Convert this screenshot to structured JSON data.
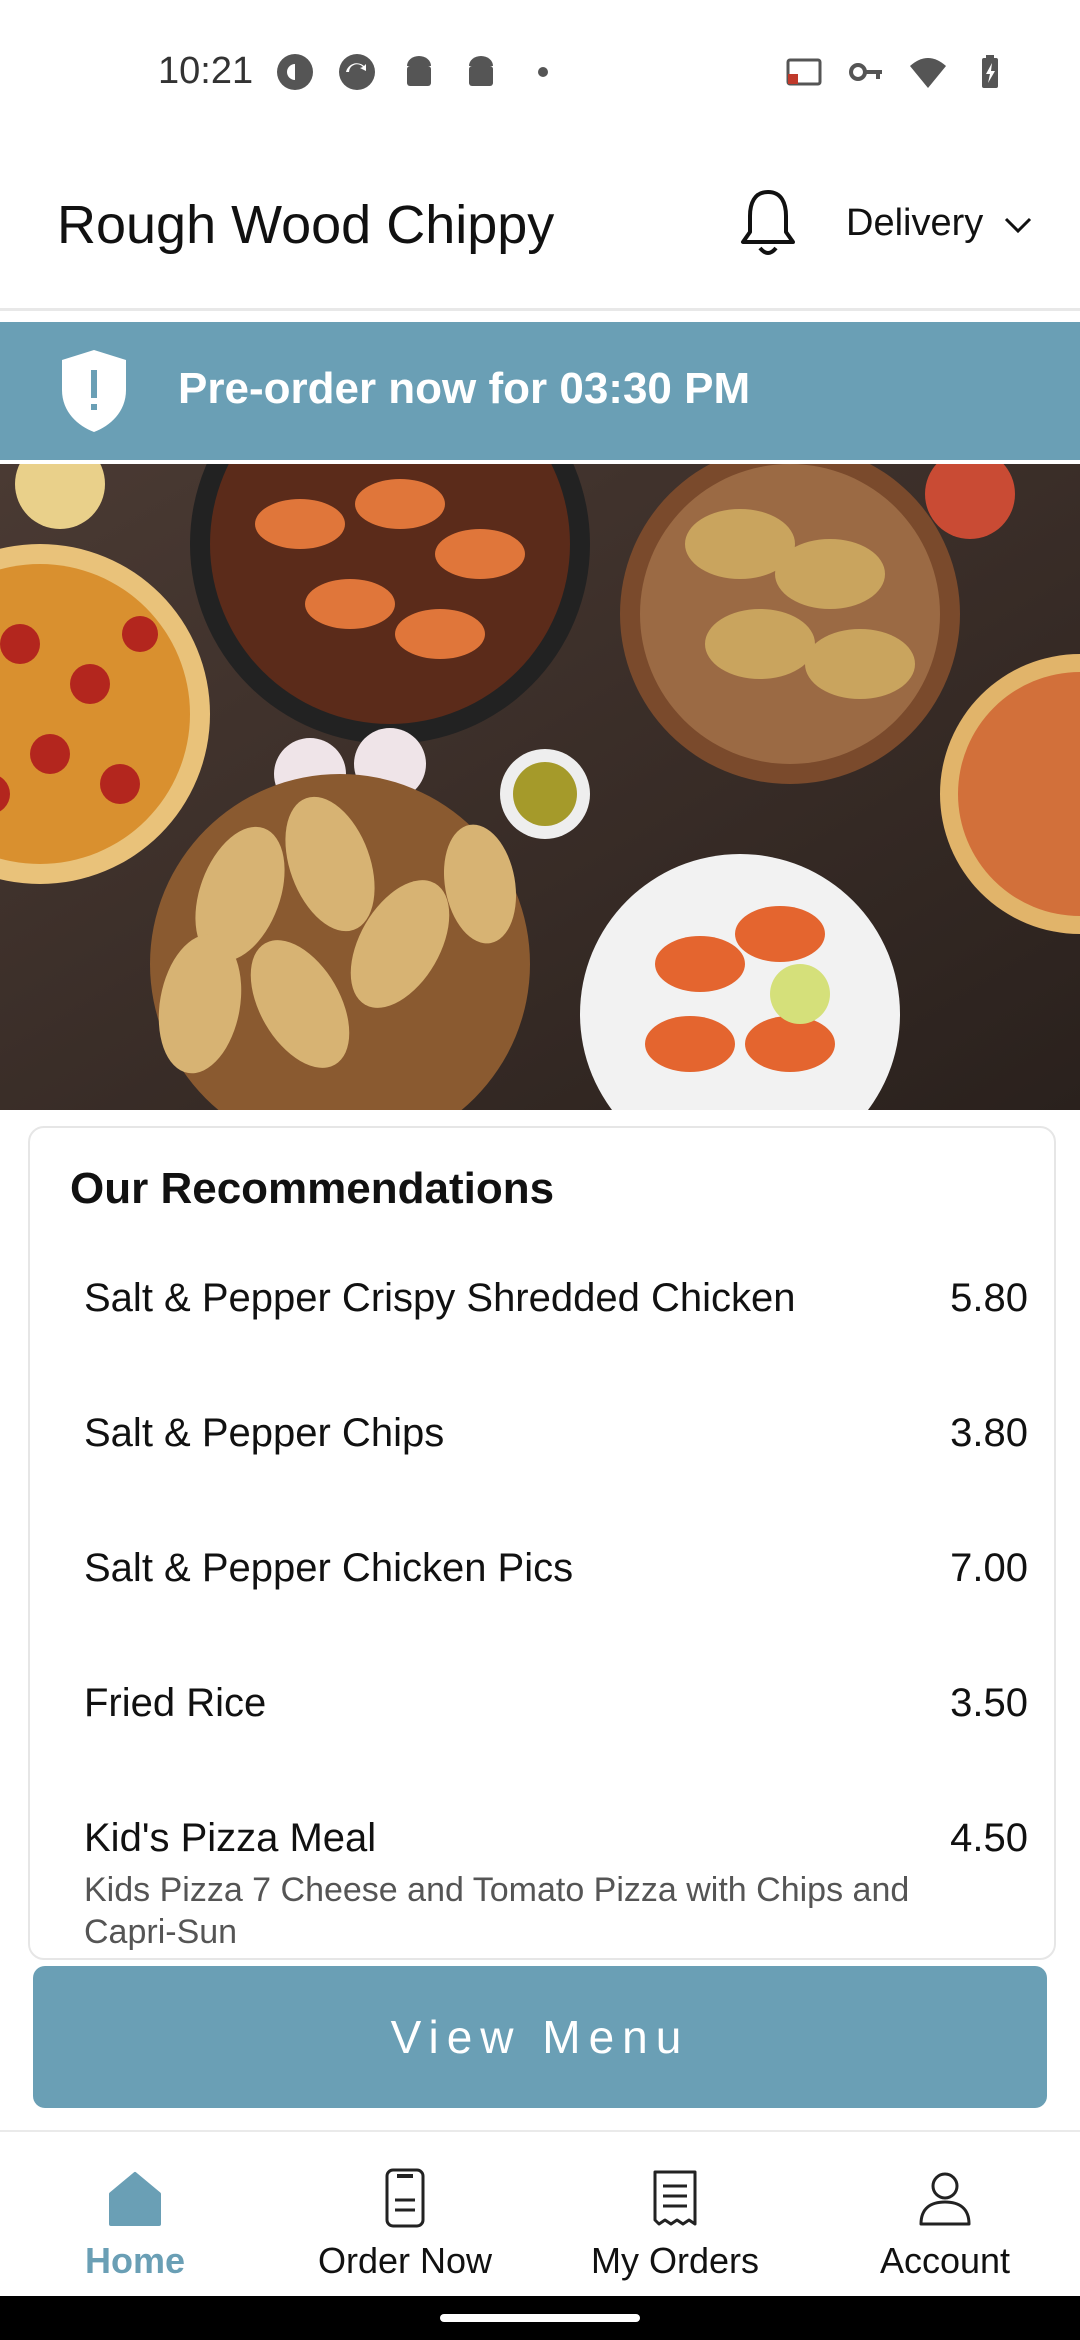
{
  "status_bar": {
    "time": "10:21",
    "left_icons": [
      "pocket-casts-icon",
      "sync-icon",
      "android-icon",
      "android-icon",
      "dot-icon"
    ],
    "right_icons": [
      "cast-icon",
      "vpn-key-icon",
      "wifi-icon",
      "battery-charging-icon"
    ]
  },
  "header": {
    "title": "Rough Wood Chippy",
    "notification_icon": "bell-icon",
    "mode": "Delivery"
  },
  "banner": {
    "icon": "shield-alert-icon",
    "text": "Pre-order now for 03:30 PM",
    "color": "#6a9fb5"
  },
  "recommendations": {
    "heading": "Our Recommendations",
    "items": [
      {
        "name": "Salt & Pepper Crispy Shredded Chicken",
        "price": "5.80",
        "description": ""
      },
      {
        "name": "Salt & Pepper Chips",
        "price": "3.80",
        "description": ""
      },
      {
        "name": "Salt & Pepper Chicken Pics",
        "price": "7.00",
        "description": ""
      },
      {
        "name": "Fried Rice",
        "price": "3.50",
        "description": ""
      },
      {
        "name": "Kid's Pizza Meal",
        "price": "4.50",
        "description": "Kids Pizza 7 Cheese and Tomato Pizza with Chips and Capri-Sun"
      }
    ]
  },
  "view_menu": {
    "label": "View Menu"
  },
  "bottom_nav": {
    "items": [
      {
        "label": "Home",
        "icon": "home-icon",
        "active": true
      },
      {
        "label": "Order Now",
        "icon": "order-icon",
        "active": false
      },
      {
        "label": "My Orders",
        "icon": "receipt-icon",
        "active": false
      },
      {
        "label": "Account",
        "icon": "person-icon",
        "active": false
      }
    ]
  },
  "colors": {
    "accent": "#6a9fb5",
    "text": "#111111",
    "muted": "#555555"
  }
}
